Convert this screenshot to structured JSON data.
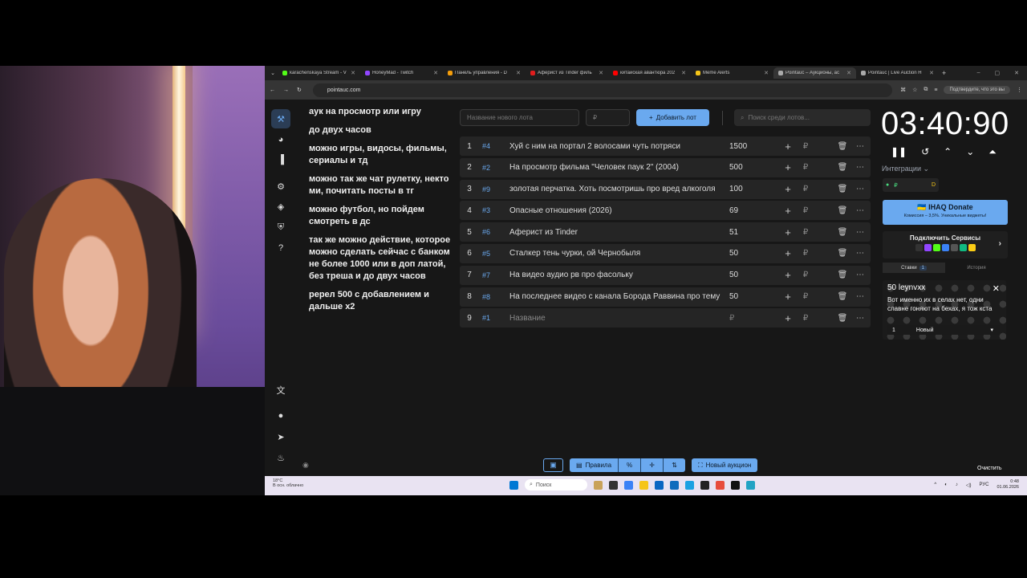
{
  "browser": {
    "tabs": [
      {
        "title": "karachenskaya Stream - V",
        "color": "#53fc18"
      },
      {
        "title": "HoneyMad - Twitch",
        "color": "#9146ff"
      },
      {
        "title": "Панель управления - D",
        "color": "#f59e0b"
      },
      {
        "title": "Аферист из Tinder филь",
        "color": "#e11d1d"
      },
      {
        "title": "китайская авантюра 202",
        "color": "#ff0000"
      },
      {
        "title": "Meme Alerts",
        "color": "#f5c518"
      },
      {
        "title": "Pointauc – Аукционы, ас",
        "color": "#aaaaaa"
      },
      {
        "title": "Pointauc | Live Auction H",
        "color": "#aaaaaa"
      }
    ],
    "url": "pointauc.com",
    "profile_hint": "Подтвердите, что это вы"
  },
  "rules": [
    "аук на просмотр или игру",
    "до  двух часов",
    "можно игры, видосы, фильмы, сериалы и тд",
    "можно так же чат рулетку, некто ми, почитать посты в тг",
    "можно футбол, но пойдем смотреть в дс",
    "так же можно действие, которое можно сделать сейчас с банком не более 1000 или в доп латой, без треша  и до двух часов",
    "ререл 500 с добавлением и дальше x2"
  ],
  "new_lot": {
    "name_placeholder": "Название нового лота",
    "amount_placeholder": "₽",
    "add_label": "Добавить лот",
    "search_placeholder": "Поиск среди лотов..."
  },
  "lots": [
    {
      "n": "1",
      "id": "#4",
      "name": "Хуй с ним на портал 2 волосами чуть потряси",
      "sum": "1500"
    },
    {
      "n": "2",
      "id": "#2",
      "name": "На просмотр фильма \"Человек паук 2\" (2004)",
      "sum": "500"
    },
    {
      "n": "3",
      "id": "#9",
      "name": "золотая перчатка. Хоть посмотришь про вред алкоголя",
      "sum": "100"
    },
    {
      "n": "4",
      "id": "#3",
      "name": "Опасные отношения (2026)",
      "sum": "69"
    },
    {
      "n": "5",
      "id": "#6",
      "name": "Аферист из Tinder",
      "sum": "51"
    },
    {
      "n": "6",
      "id": "#5",
      "name": "Сталкер тень чурки, ой Чернобыля",
      "sum": "50"
    },
    {
      "n": "7",
      "id": "#7",
      "name": "На видео аудио рв про фасольку",
      "sum": "50"
    },
    {
      "n": "8",
      "id": "#8",
      "name": "На последнее видео с канала Борода Раввина про тему",
      "sum": "50"
    },
    {
      "n": "9",
      "id": "#1",
      "name": "Название",
      "sum": "₽"
    }
  ],
  "timer": "03:40:90",
  "integrations_label": "Интеграции",
  "donate": {
    "title": "IHAQ Donate",
    "subtitle": "Комиссия – 3,5%. Уникальные виджеты!"
  },
  "services_label": "Подключить Сервисы",
  "bids_tabs": {
    "bids": "Ставки",
    "bids_count": "1",
    "history": "История"
  },
  "bid": {
    "title": "50 leynvxx",
    "text": "Вот именно их в селах нет, одни славне гоняют на бехах, я тож кста",
    "amount": "1",
    "status": "Новый"
  },
  "clear_label": "Очистить",
  "bottom": {
    "rules": "Правила",
    "new_auction": "Новый аукцион"
  },
  "taskbar": {
    "weather_temp": "18°C",
    "weather_desc": "В осн. облачно",
    "search": "Поиск",
    "lang": "РУС",
    "time": "0:48",
    "date": "01.06.2026"
  }
}
